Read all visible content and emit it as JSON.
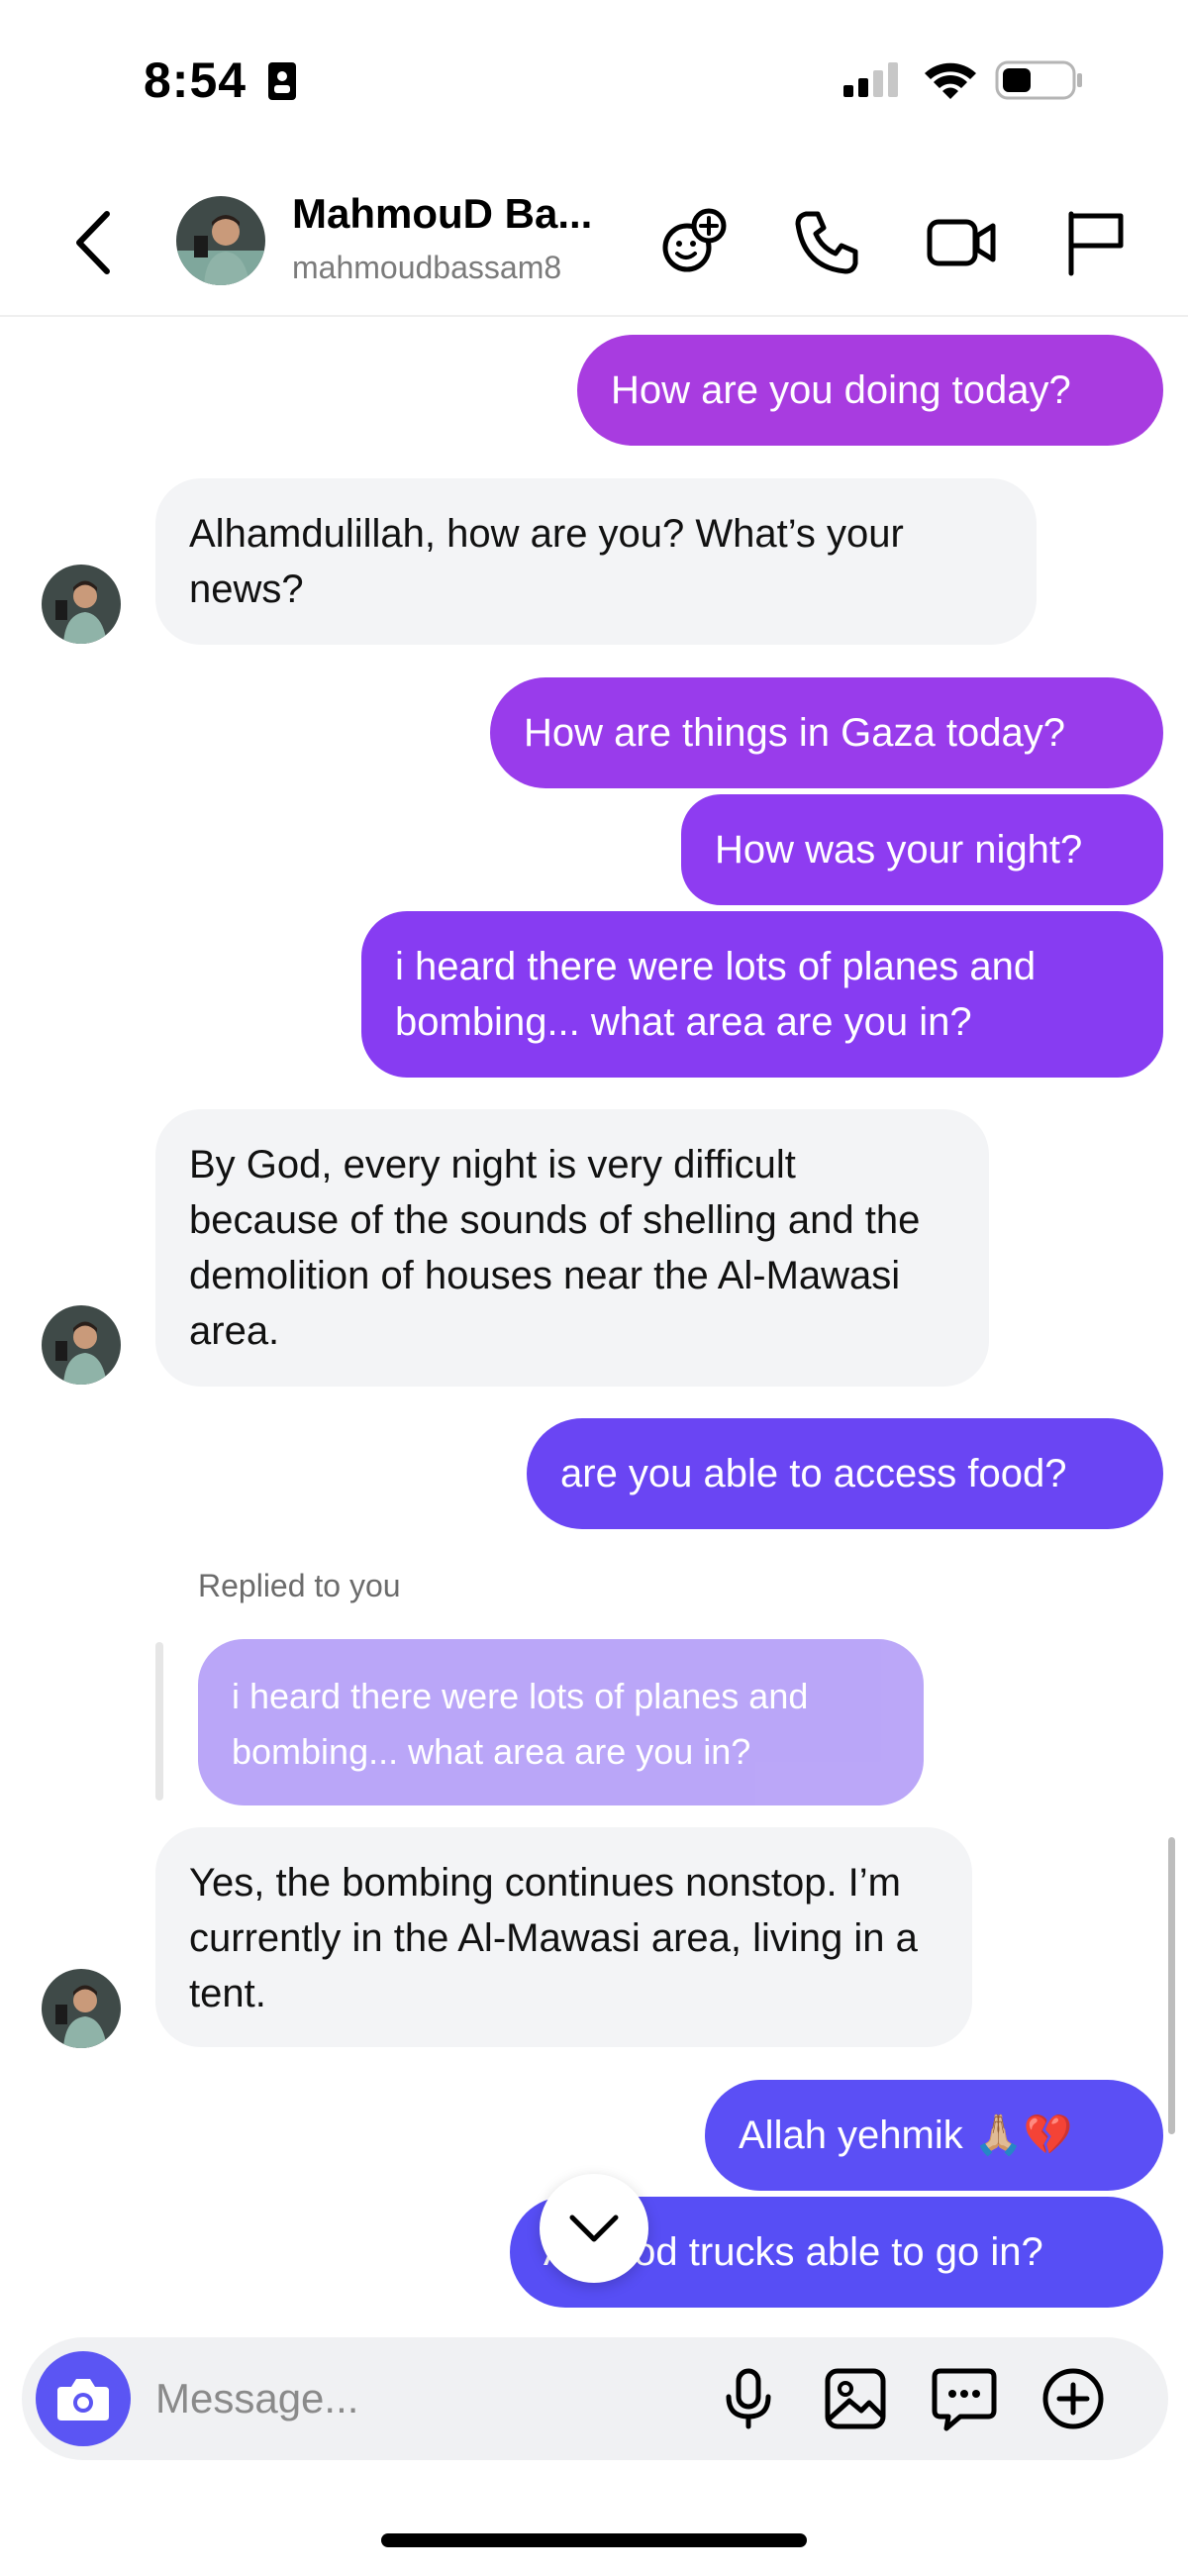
{
  "status_bar": {
    "time": "8:54",
    "icons": [
      "id-card-icon",
      "cellular-signal-icon",
      "wifi-icon",
      "battery-icon"
    ]
  },
  "header": {
    "contact_name": "MahmouD Ba...",
    "contact_handle": "mahmoudbassam8",
    "icons": [
      "back-chevron-icon",
      "avatar",
      "add-effects-icon",
      "phone-icon",
      "video-icon",
      "flag-icon"
    ]
  },
  "conversation": {
    "messages": [
      {
        "side": "out",
        "text": "How are you doing today?"
      },
      {
        "side": "in",
        "text": "Alhamdulillah, how are you? What’s your news?"
      },
      {
        "side": "out",
        "text": "How are things in Gaza today?"
      },
      {
        "side": "out",
        "text": "How was your night?"
      },
      {
        "side": "out",
        "text": "i heard there were lots of planes and bombing... what area are you in?"
      },
      {
        "side": "in",
        "text": "By God, every night is very difficult because of the sounds of shelling and the demolition of houses near the Al-Mawasi area."
      },
      {
        "side": "out",
        "text": "are you able to access food?"
      },
      {
        "side": "in",
        "text": "Yes, the bombing continues nonstop. I’m currently in the Al-Mawasi area, living in a tent.",
        "reply_label": "Replied to you",
        "quoted_text": "i heard there were lots of planes and bombing... what area are you in?"
      },
      {
        "side": "out",
        "text": "Allah yehmik 🙏🏼💔"
      },
      {
        "side": "out",
        "text": "Are food trucks able to go in?",
        "visible_text": "A    ood trucks able to go in?"
      }
    ]
  },
  "composer": {
    "placeholder": "Message...",
    "icons": [
      "camera-icon",
      "microphone-icon",
      "gallery-icon",
      "sticker-chat-icon",
      "add-circle-icon"
    ]
  },
  "colors": {
    "bubble_pink": "#a83ce0",
    "bubble_purple": "#8a3cf0",
    "bubble_violet": "#5b4ff5",
    "incoming": "#f3f4f6",
    "accent": "#5b55f3"
  }
}
